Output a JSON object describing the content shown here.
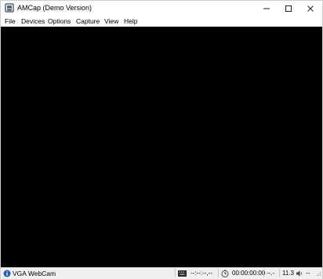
{
  "window": {
    "title": "AMCap (Demo Version)"
  },
  "menu": {
    "items": [
      "File",
      "Devices",
      "Options",
      "Capture",
      "View",
      "Help"
    ]
  },
  "preview": {
    "background": "#000000"
  },
  "statusbar": {
    "device": "VGA WebCam",
    "date": "--:--:--,--",
    "time": "00:00:00:00",
    "rate": "--.-",
    "fps": "11.3",
    "audio": "--"
  },
  "icons": {
    "app": "camera-icon",
    "minimize": "minimize-icon",
    "maximize": "maximize-icon",
    "close": "close-icon",
    "info": "info-icon",
    "keyboard": "keyboard-icon",
    "clock": "clock-icon",
    "speaker": "speaker-icon",
    "grip": "resize-grip-icon"
  }
}
